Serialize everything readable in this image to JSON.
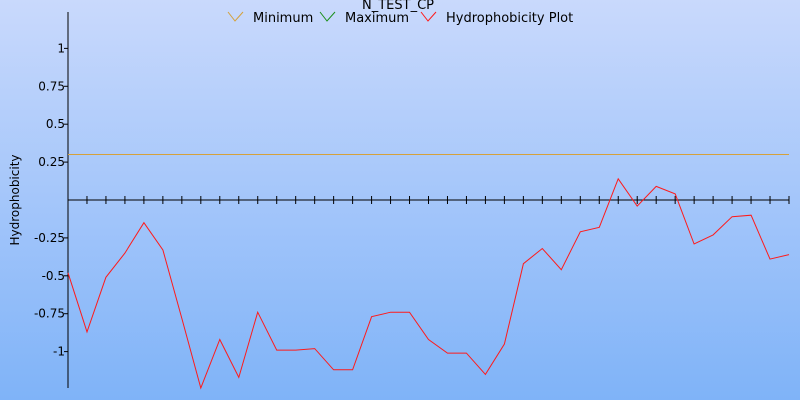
{
  "colors": {
    "bg_top": "#c9d9fc",
    "bg_bottom": "#7fb3f8",
    "minimum": "#d5a13a",
    "maximum": "#1a8f1a",
    "hydrophobicity": "#ff1a1a",
    "axis": "#000000"
  },
  "chart_data": {
    "type": "line",
    "title": "N_TEST_CP",
    "xlabel": "",
    "ylabel": "Hydrophobicity",
    "ylim": [
      -1.24,
      1.24
    ],
    "yticks": [
      1,
      0.75,
      0.5,
      0.25,
      -0.25,
      -0.5,
      -0.75,
      -1
    ],
    "ytick_labels": [
      "1",
      "0.75",
      "0.5",
      "0.25",
      "-0.25",
      "-0.5",
      "-0.75",
      "-1"
    ],
    "x_count": 39,
    "legend": {
      "placement": "top-center"
    },
    "series": [
      {
        "name": "Minimum",
        "color": "#d5a13a",
        "values": [
          0.3,
          0.3,
          0.3,
          0.3,
          0.3,
          0.3,
          0.3,
          0.3,
          0.3,
          0.3,
          0.3,
          0.3,
          0.3,
          0.3,
          0.3,
          0.3,
          0.3,
          0.3,
          0.3,
          0.3,
          0.3,
          0.3,
          0.3,
          0.3,
          0.3,
          0.3,
          0.3,
          0.3,
          0.3,
          0.3,
          0.3,
          0.3,
          0.3,
          0.3,
          0.3,
          0.3,
          0.3,
          0.3,
          0.3
        ]
      },
      {
        "name": "Maximum",
        "color": "#1a8f1a",
        "values": []
      },
      {
        "name": "Hydrophobicity Plot",
        "color": "#ff1a1a",
        "values": [
          -0.48,
          -0.87,
          -0.51,
          -0.35,
          -0.15,
          -0.33,
          -0.78,
          -1.24,
          -0.92,
          -1.17,
          -0.74,
          -0.99,
          -0.99,
          -0.98,
          -1.12,
          -1.12,
          -0.77,
          -0.74,
          -0.74,
          -0.92,
          -1.01,
          -1.01,
          -1.15,
          -0.95,
          -0.42,
          -0.32,
          -0.46,
          -0.21,
          -0.18,
          0.14,
          -0.04,
          0.09,
          0.04,
          -0.29,
          -0.23,
          -0.11,
          -0.1,
          -0.39,
          -0.36
        ]
      }
    ]
  }
}
